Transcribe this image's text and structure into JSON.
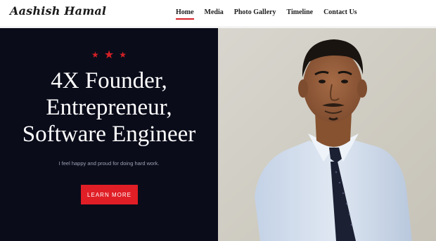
{
  "site": {
    "logo_text": "Aashish Hamal"
  },
  "nav": {
    "items": [
      {
        "label": "Home",
        "active": true
      },
      {
        "label": "Media",
        "active": false
      },
      {
        "label": "Photo Gallery",
        "active": false
      },
      {
        "label": "Timeline",
        "active": false
      },
      {
        "label": "Contact Us",
        "active": false
      }
    ]
  },
  "hero": {
    "stars": [
      "★",
      "★",
      "★"
    ],
    "headline": [
      "4X Founder,",
      "Entrepreneur,",
      "Software Engineer"
    ],
    "tagline": "I feel happy and proud for doing hard work.",
    "cta_label": "LEARN MORE"
  },
  "colors": {
    "accent": "#e01e26",
    "hero_bg": "#0a0c1a",
    "photo_bg": "#d2cfc6",
    "text_dark": "#1c1c1c"
  }
}
